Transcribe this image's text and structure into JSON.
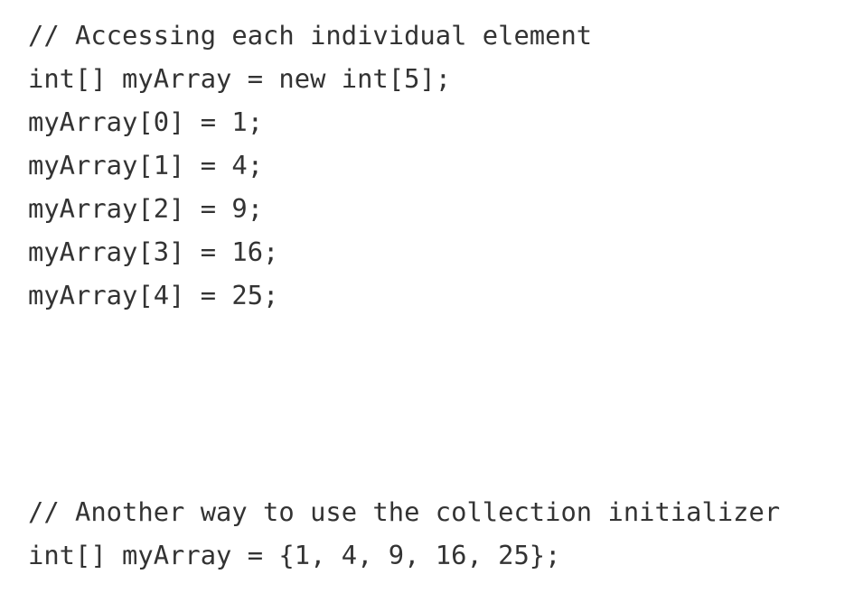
{
  "code": {
    "lines": [
      "// Accessing each individual element",
      "int[] myArray = new int[5];",
      "myArray[0] = 1;",
      "myArray[1] = 4;",
      "myArray[2] = 9;",
      "myArray[3] = 16;",
      "myArray[4] = 25;",
      "// Another way to use the collection initializer",
      "int[] myArray = {1, 4, 9, 16, 25};"
    ]
  }
}
